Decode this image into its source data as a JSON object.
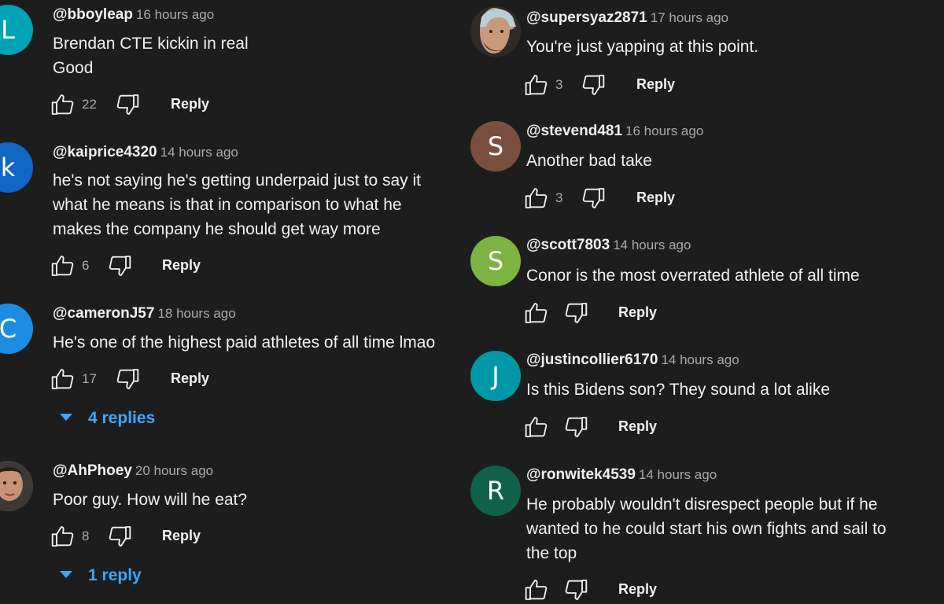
{
  "left_column": [
    {
      "avatar_letter": "L",
      "avatar_color": "#00a3b4",
      "author": "@bboyleap",
      "time": "16 hours ago",
      "lines": [
        "Brendan CTE kickin in real",
        "Good"
      ],
      "likes": "22",
      "reply_label": "Reply"
    },
    {
      "avatar_letter": "k",
      "avatar_color": "#1166c6",
      "author": "@kaiprice4320",
      "time": "14 hours ago",
      "lines": [
        "he's not saying he's getting underpaid just to say it",
        "what he means is that in comparison to what he",
        "makes the company he should get way more"
      ],
      "likes": "6",
      "reply_label": "Reply"
    },
    {
      "avatar_letter": "C",
      "avatar_color": "#1a8de0",
      "author": "@cameronJ57",
      "time": "18 hours ago",
      "lines": [
        "He's one of the highest paid athletes of all time lmao"
      ],
      "likes": "17",
      "reply_label": "Reply",
      "replies_label": "4 replies"
    },
    {
      "avatar_letter": "",
      "avatar_color": "#5b4a3c",
      "avatar_icon": "profile-photo",
      "author": "@AhPhoey",
      "time": "20 hours ago",
      "lines": [
        "Poor guy.  How will he eat?"
      ],
      "likes": "8",
      "reply_label": "Reply",
      "replies_label": "1 reply"
    }
  ],
  "right_column": [
    {
      "avatar_letter": "",
      "avatar_color": "#4a3a30",
      "avatar_icon": "profile-photo",
      "author": "@supersyaz2871",
      "time": "17 hours ago",
      "lines": [
        "You're just yapping at this point."
      ],
      "likes": "3",
      "reply_label": "Reply"
    },
    {
      "avatar_letter": "S",
      "avatar_color": "#79503d",
      "author": "@stevend481",
      "time": "16 hours ago",
      "lines": [
        "Another bad take"
      ],
      "likes": "3",
      "reply_label": "Reply"
    },
    {
      "avatar_letter": "S",
      "avatar_color": "#7cb342",
      "author": "@scott7803",
      "time": "14 hours ago",
      "lines": [
        "Conor is the most overrated athlete of all time"
      ],
      "likes": "",
      "reply_label": "Reply"
    },
    {
      "avatar_letter": "J",
      "avatar_color": "#0097a7",
      "author": "@justincollier6170",
      "time": "14 hours ago",
      "lines": [
        "Is this Bidens son? They sound a lot alike"
      ],
      "likes": "",
      "reply_label": "Reply"
    },
    {
      "avatar_letter": "R",
      "avatar_color": "#10614a",
      "author": "@ronwitek4539",
      "time": "14 hours ago",
      "lines": [
        "He probably wouldn't disrespect people but if he",
        "wanted to he could start his own  fights and sail to",
        "the top"
      ],
      "likes": "",
      "reply_label": "Reply"
    }
  ],
  "icons": {
    "like": "thumbs-up-icon",
    "dislike": "thumbs-down-icon",
    "expand": "caret-down-icon"
  },
  "colors": {
    "background": "#1d1d1d",
    "link": "#3ea6ff",
    "secondary_text": "#aaaaaa"
  }
}
